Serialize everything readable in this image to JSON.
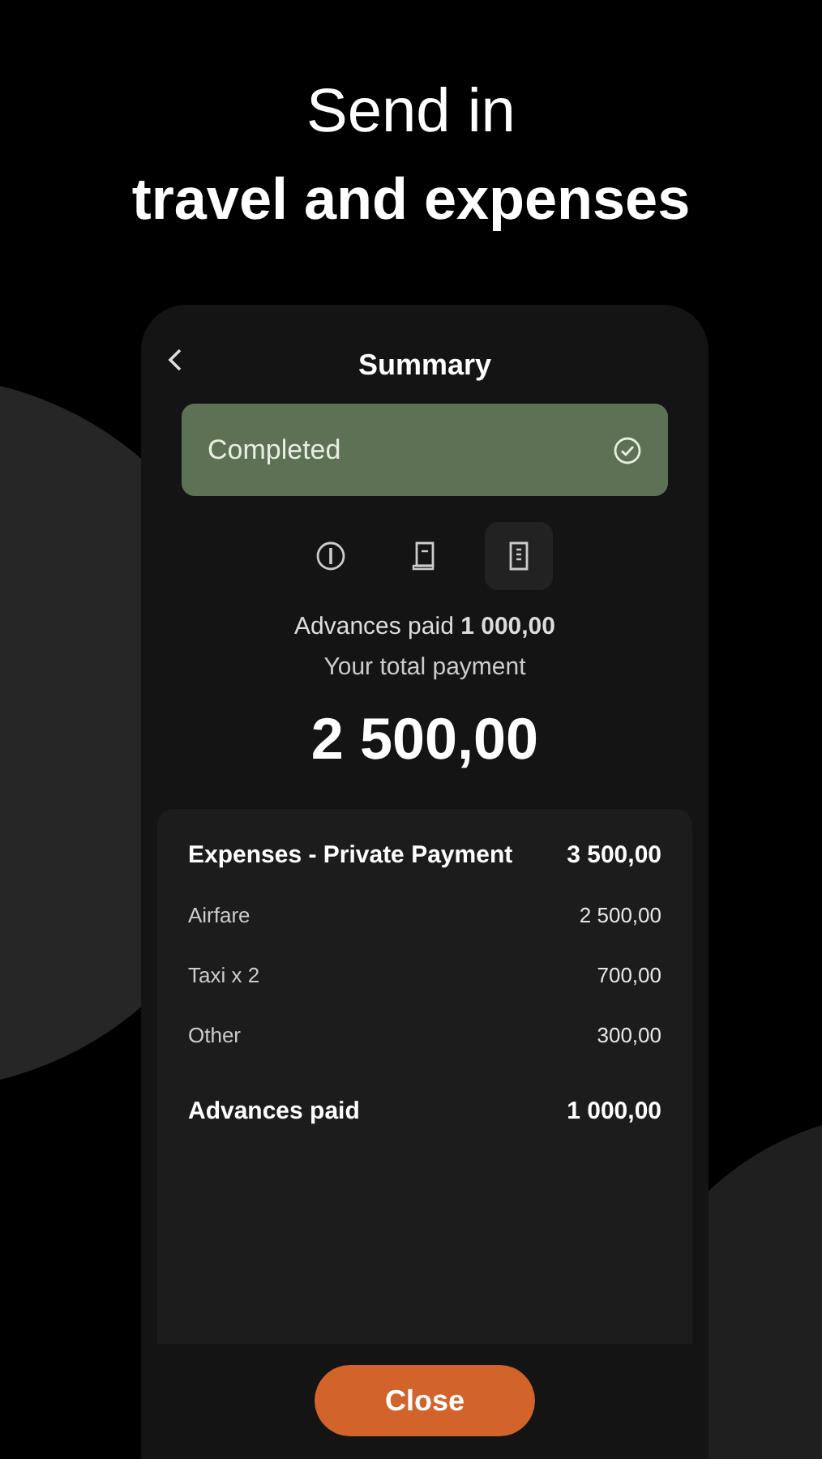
{
  "headline": {
    "line_1": "Send in",
    "line_2": "travel and expenses"
  },
  "screen": {
    "title": "Summary",
    "status": {
      "label": "Completed",
      "done": true
    },
    "tabs": [
      {
        "kind": "info",
        "selected": false
      },
      {
        "kind": "receipt",
        "selected": false
      },
      {
        "kind": "summary",
        "selected": true
      }
    ],
    "advances_line": "Advances paid **1 000,00**",
    "total_label": "Your total payment",
    "total_amount": "2 500,00",
    "rows": [
      {
        "kind": "header",
        "label": "Expenses - Private Payment",
        "amount": "3 500,00"
      },
      {
        "kind": "item",
        "label": "Airfare",
        "amount": "2 500,00"
      },
      {
        "kind": "item",
        "label": "Taxi x 2",
        "amount": "700,00"
      },
      {
        "kind": "item",
        "label": "Other",
        "amount": "300,00"
      },
      {
        "kind": "total",
        "label": "Advances paid",
        "amount": "1 000,00"
      }
    ],
    "button": "Close"
  }
}
